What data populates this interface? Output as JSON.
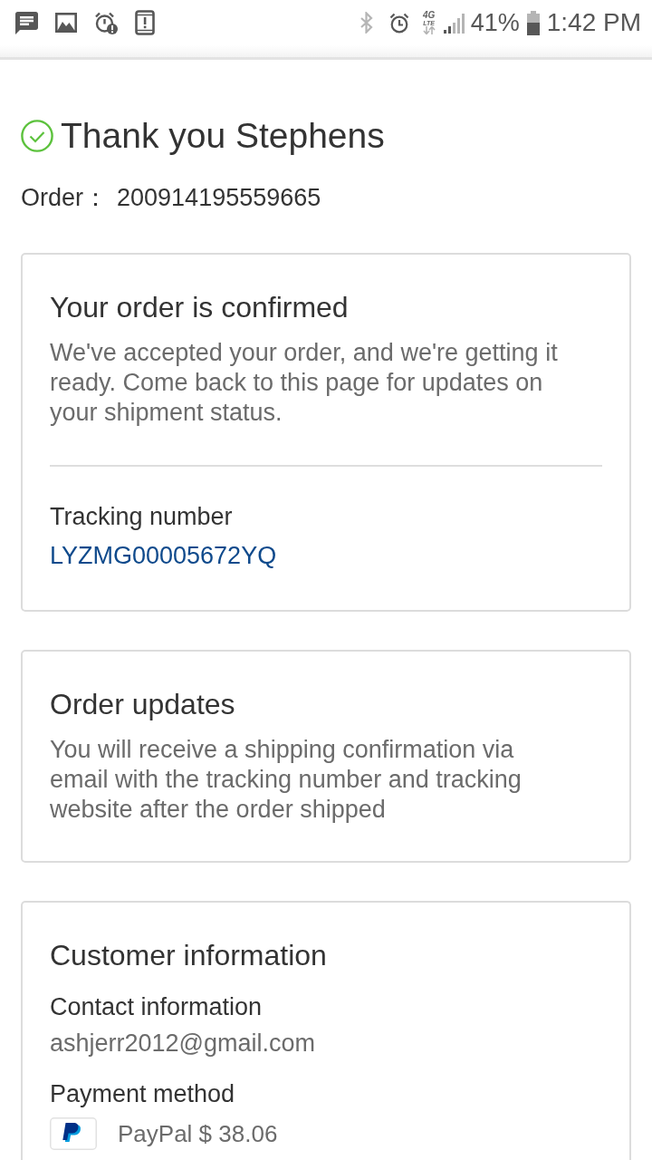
{
  "status_bar": {
    "network_type": "4G",
    "network_sub": "LTE",
    "battery_percent": "41%",
    "time": "1:42 PM"
  },
  "header": {
    "title": "Thank you Stephens",
    "order_label": "Order：",
    "order_number": "200914195559665"
  },
  "cards": [
    {
      "title": "Your order is confirmed",
      "text": "We've accepted your order, and we're getting it ready. Come back to this page for updates on your shipment status.",
      "fields": [
        {
          "kind": "link",
          "label": "Tracking number",
          "value": "LYZMG00005672YQ"
        }
      ]
    },
    {
      "title": "Order updates",
      "text": "You will receive a shipping confirmation via email with the tracking number and tracking website after the order shipped"
    },
    {
      "title": "Customer information",
      "fields": [
        {
          "kind": "text",
          "label": "Contact information",
          "value": "ashjerr2012@gmail.com"
        },
        {
          "kind": "payment",
          "label": "Payment method",
          "value": "PayPal $ 38.06"
        }
      ]
    }
  ]
}
